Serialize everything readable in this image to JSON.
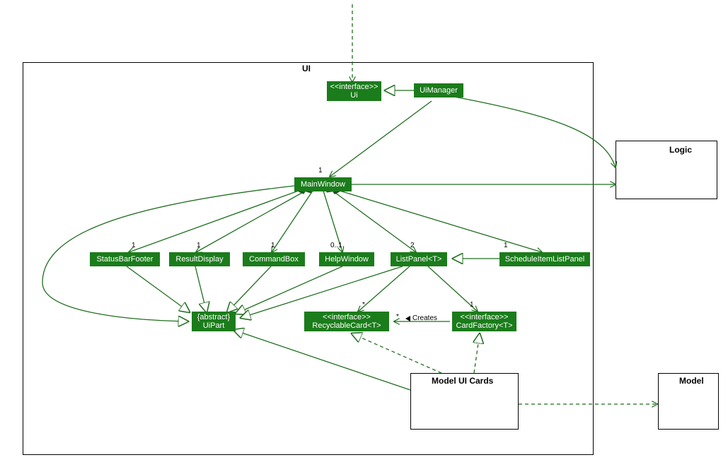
{
  "packages": {
    "ui": {
      "title": "UI"
    },
    "logic": {
      "title": "Logic"
    },
    "modelUiCards": {
      "title": "Model UI Cards"
    },
    "model": {
      "title": "Model"
    }
  },
  "nodes": {
    "uiInterface": {
      "stereotype": "<<interface>>",
      "name": "Ui"
    },
    "uiManager": {
      "name": "UiManager"
    },
    "mainWindow": {
      "name": "MainWindow"
    },
    "statusBarFooter": {
      "name": "StatusBarFooter"
    },
    "resultDisplay": {
      "name": "ResultDisplay"
    },
    "commandBox": {
      "name": "CommandBox"
    },
    "helpWindow": {
      "name": "HelpWindow"
    },
    "listPanel": {
      "name": "ListPanel<T>"
    },
    "scheduleItemListPanel": {
      "name": "ScheduleItemListPanel"
    },
    "uiPart": {
      "stereotype": "{abstract}",
      "name": "UiPart"
    },
    "recyclableCard": {
      "stereotype": "<<interface>>",
      "name": "RecyclableCard<T>"
    },
    "cardFactory": {
      "stereotype": "<<interface>>",
      "name": "CardFactory<T>"
    }
  },
  "multiplicities": {
    "mainWindow1": "1",
    "statusBarFooter1": "1",
    "resultDisplay1": "1",
    "commandBox1": "1",
    "helpWindow01": "0..1",
    "listPanel2": "2",
    "scheduleItemListPanel1": "1",
    "recyclableStar": "*",
    "createsStar": "*",
    "cardFactory1": "1"
  },
  "labels": {
    "creates": "Creates"
  },
  "colors": {
    "node": "#1b7c1b",
    "edge": "#1f6f1f"
  }
}
